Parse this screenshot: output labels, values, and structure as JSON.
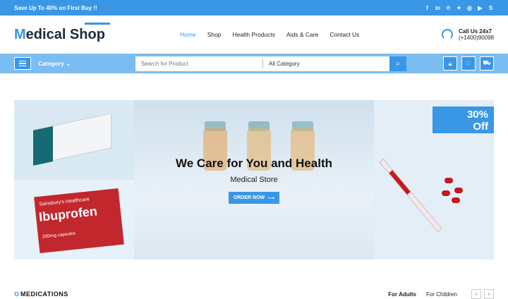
{
  "topbar": {
    "promo": "Save Up To 40% on First Buy !!",
    "social_icons": [
      "facebook-icon",
      "linkedin-icon",
      "pinterest-icon",
      "twitter-icon",
      "instagram-icon",
      "youtube-icon",
      "skype-icon"
    ]
  },
  "header": {
    "logo_first": "M",
    "logo_rest": "edical Shop",
    "nav": [
      "Home",
      "Shop",
      "Health Products",
      "Aids & Care",
      "Contact Us"
    ],
    "call_label": "Call Us 24x7",
    "call_number": "(+1400)90098"
  },
  "toolbar": {
    "category_label": "Category",
    "search_placeholder": "Search for Product",
    "all_category": "All Category"
  },
  "banner": {
    "title": "We Care for You and Health",
    "subtitle": "Medical Store",
    "button": "ORDER NOW",
    "discount_pct": "30%",
    "discount_word": "Off",
    "product_brand": "Sainsbury's Healthcare",
    "product_name": "Ibuprofen",
    "product_dose": "200mg capsules"
  },
  "section": {
    "title": "MEDICATIONS",
    "tabs": [
      "For Adults",
      "For Children"
    ]
  },
  "colors": {
    "accent": "#3a97e6",
    "bar": "#7bbcf1"
  }
}
